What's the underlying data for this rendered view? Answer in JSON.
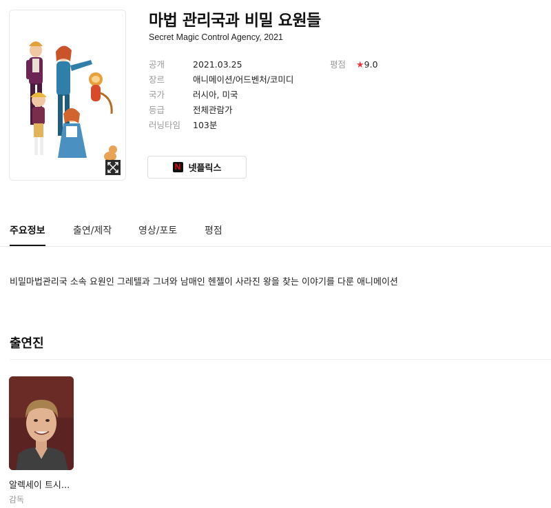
{
  "movie": {
    "title": "마법 관리국과 비밀 요원들",
    "subtitle": "Secret Magic Control Agency, 2021"
  },
  "info": {
    "release": {
      "label": "공개",
      "value": "2021.03.25"
    },
    "genre": {
      "label": "장르",
      "value": "애니메이션/어드벤처/코미디"
    },
    "country": {
      "label": "국가",
      "value": "러시아, 미국"
    },
    "grade": {
      "label": "등급",
      "value": "전체관람가"
    },
    "runtime": {
      "label": "러닝타임",
      "value": "103분"
    },
    "rating": {
      "label": "평점",
      "star": "★",
      "value": "9.0"
    }
  },
  "watch": {
    "logo_letter": "N",
    "label": "넷플릭스"
  },
  "tabs": [
    {
      "label": "주요정보",
      "active": true
    },
    {
      "label": "출연/제작",
      "active": false
    },
    {
      "label": "영상/포토",
      "active": false
    },
    {
      "label": "평점",
      "active": false
    }
  ],
  "synopsis": "비밀마법관리국 소속 요원인 그레텔과 그녀와 남매인 헨젤이 사라진 왕을 찾는 이야기를 다룬 애니메이션",
  "cast_section": {
    "title": "출연진",
    "members": [
      {
        "name": "알렉세이 트시...",
        "role": "감독"
      }
    ]
  },
  "colors": {
    "rating_star": "#e8373e",
    "netflix_red": "#e50914",
    "label_gray": "#9a9a9a"
  },
  "icons": {
    "expand": "expand-icon",
    "netflix": "netflix-logo-icon",
    "star": "star-icon"
  }
}
